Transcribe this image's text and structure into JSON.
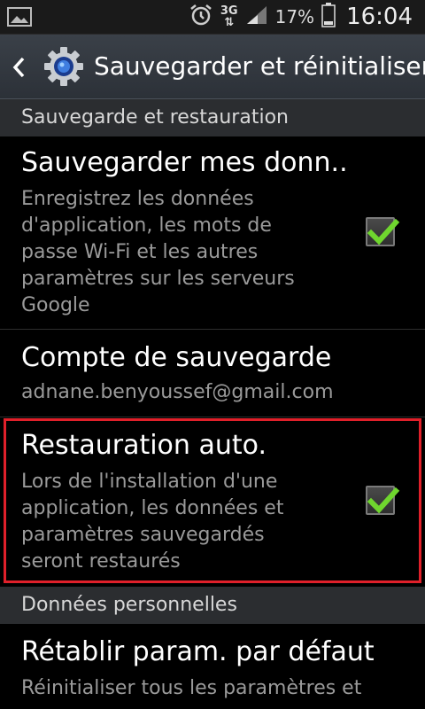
{
  "status_bar": {
    "network_label": "3G",
    "battery_percent": "17%",
    "time": "16:04"
  },
  "action_bar": {
    "title": "Sauvegarder et réinitialiser"
  },
  "sections": {
    "backup_header": "Sauvegarde et restauration",
    "personal_header": "Données personnelles"
  },
  "items": {
    "backup_data": {
      "title": "Sauvegarder mes donn..",
      "summary_lines": [
        "Enregistrez les données",
        "d'application, les mots de",
        "passe Wi-Fi et les autres",
        "paramètres sur les serveurs",
        "Google"
      ],
      "checked": true
    },
    "backup_account": {
      "title": "Compte de sauvegarde",
      "summary": "adnane.benyoussef@gmail.com"
    },
    "auto_restore": {
      "title": "Restauration auto.",
      "summary_lines": [
        "Lors de l'installation d'une",
        "application, les données et",
        "paramètres sauvegardés",
        "seront restaurés"
      ],
      "checked": true
    },
    "factory_reset": {
      "title": "Rétablir param. par défaut",
      "summary": "Réinitialiser tous les paramètres et"
    }
  },
  "icons": {
    "status_left": "gallery-icon",
    "status_right": [
      "alarm-icon",
      "data-arrows-icon",
      "signal-icon",
      "battery-icon"
    ],
    "action": [
      "back-chevron-icon",
      "settings-gear-icon"
    ],
    "check": "check-icon"
  },
  "colors": {
    "highlight": "#e0202a",
    "check": "#6fd62e",
    "summary_text": "#9a9a9a",
    "section_bg": "#2b2d30"
  }
}
